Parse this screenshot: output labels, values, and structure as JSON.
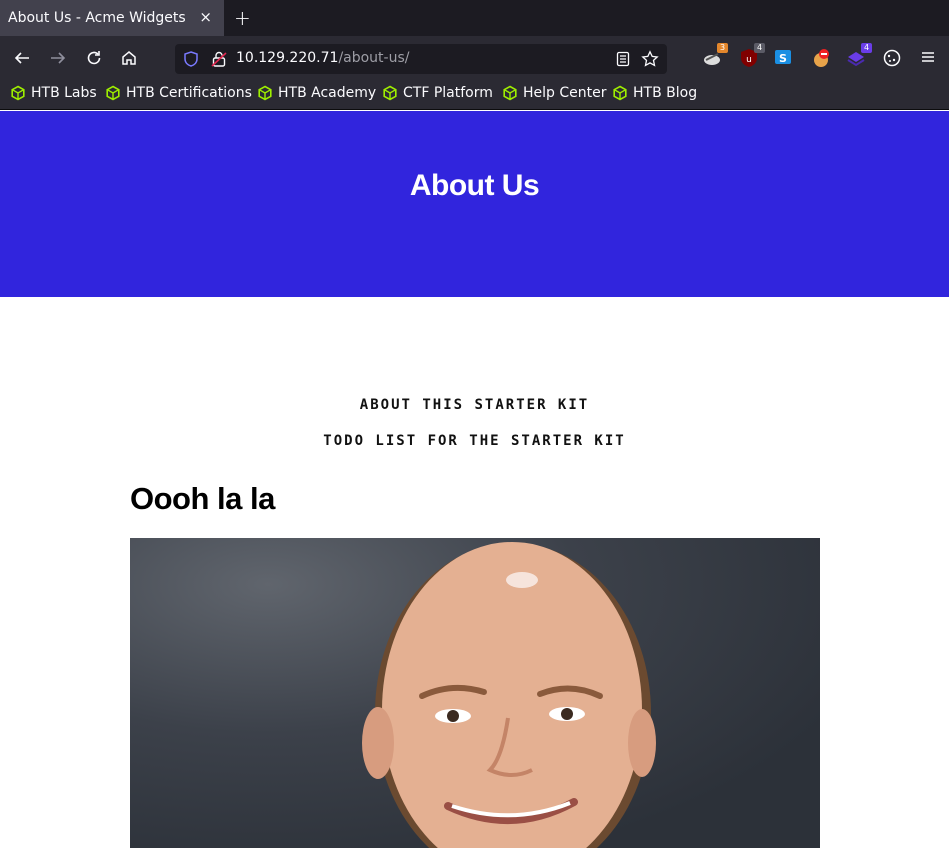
{
  "browser": {
    "tab_title": "About Us - Acme Widgets",
    "tab_close": "×",
    "new_tab": "+",
    "url_host": "10.129.220.71",
    "url_path": "/about-us/",
    "extensions": [
      {
        "name": "ext-1",
        "badge": "3",
        "color": "#e3862c"
      },
      {
        "name": "ublock",
        "badge": "4",
        "color": "#800000"
      },
      {
        "name": "ext-s",
        "badge": "",
        "color": "#1a8fe3"
      },
      {
        "name": "ext-stop",
        "badge": "",
        "color": "#e23"
      },
      {
        "name": "ext-layers",
        "badge": "4",
        "color": "#6a3de8"
      },
      {
        "name": "cookie",
        "badge": "",
        "color": "#fbfbfe"
      }
    ],
    "bookmarks": [
      "HTB Labs",
      "HTB Certifications",
      "HTB Academy",
      "CTF Platform",
      "Help Center",
      "HTB Blog"
    ]
  },
  "page": {
    "hero_title": "About Us",
    "hero_color": "#3125dd",
    "nav_links": [
      "ABOUT THIS STARTER KIT",
      "TODO LIST FOR THE STARTER KIT"
    ],
    "heading": "Oooh la la",
    "photo_alt": "portrait-photo"
  }
}
